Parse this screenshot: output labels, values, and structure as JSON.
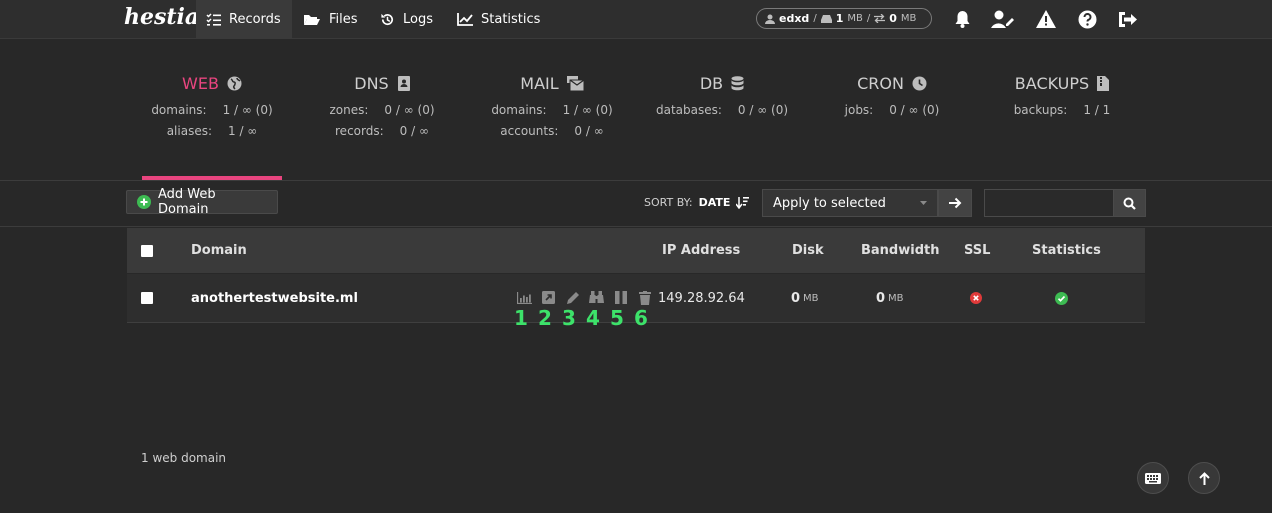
{
  "app": {
    "logo": "hestia"
  },
  "nav": [
    {
      "label": "Records",
      "icon": "list-check-icon"
    },
    {
      "label": "Files",
      "icon": "folder-open-icon"
    },
    {
      "label": "Logs",
      "icon": "history-icon"
    },
    {
      "label": "Statistics",
      "icon": "chart-line-icon"
    }
  ],
  "user": {
    "name": "edxd",
    "disk_used": "1",
    "disk_unit": "MB",
    "bw_used": "0",
    "bw_unit": "MB"
  },
  "stats": [
    {
      "title": "WEB",
      "active": true,
      "rows": [
        {
          "label": "domains:",
          "value": "1 / ∞ (0)"
        },
        {
          "label": "aliases:",
          "value": "1 / ∞"
        }
      ]
    },
    {
      "title": "DNS",
      "rows": [
        {
          "label": "zones:",
          "value": "0 / ∞ (0)"
        },
        {
          "label": "records:",
          "value": "0 / ∞"
        }
      ]
    },
    {
      "title": "MAIL",
      "rows": [
        {
          "label": "domains:",
          "value": "1 / ∞ (0)"
        },
        {
          "label": "accounts:",
          "value": "0 / ∞"
        }
      ]
    },
    {
      "title": "DB",
      "rows": [
        {
          "label": "databases:",
          "value": "0 / ∞ (0)"
        }
      ]
    },
    {
      "title": "CRON",
      "rows": [
        {
          "label": "jobs:",
          "value": "0 / ∞ (0)"
        }
      ]
    },
    {
      "title": "BACKUPS",
      "rows": [
        {
          "label": "backups:",
          "value": "1 / 1"
        }
      ]
    }
  ],
  "toolbar": {
    "add_label": "Add Web Domain",
    "sort_by": "SORT BY:",
    "sort_value": "DATE",
    "bulk_select": "Apply to selected",
    "search_placeholder": ""
  },
  "table": {
    "headers": {
      "domain": "Domain",
      "ip": "IP Address",
      "disk": "Disk",
      "bandwidth": "Bandwidth",
      "ssl": "SSL",
      "stats": "Statistics"
    },
    "rows": [
      {
        "domain": "anothertestwebsite.ml",
        "ip": "149.28.92.64",
        "disk": "0",
        "disk_unit": "MB",
        "bandwidth": "0",
        "bandwidth_unit": "MB",
        "ssl": false,
        "stats": true
      }
    ]
  },
  "action_numbers": [
    "1",
    "2",
    "3",
    "4",
    "5",
    "6"
  ],
  "footer": {
    "count": "1 web domain"
  },
  "colors": {
    "accent": "#e9457f",
    "ok": "#3dbb52",
    "error": "#e03a3a",
    "annotation": "#3de26a"
  }
}
